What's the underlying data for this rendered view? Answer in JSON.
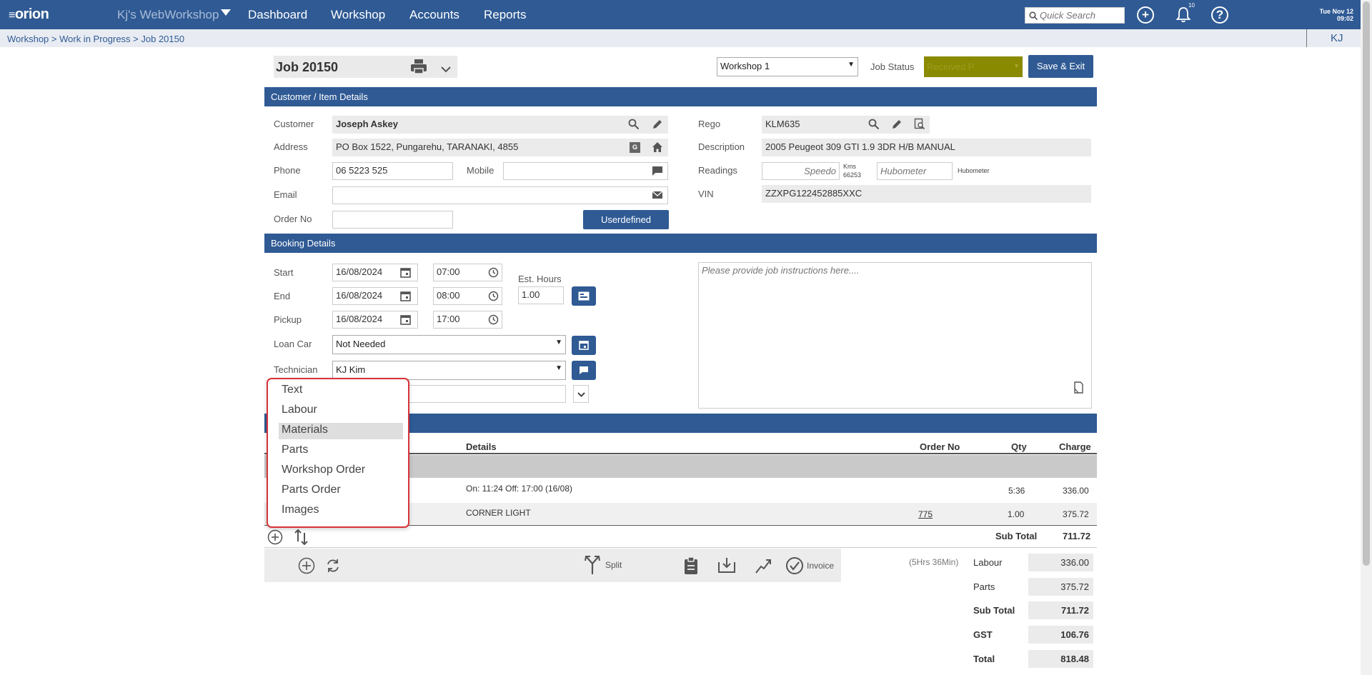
{
  "topbar": {
    "logo": "orion",
    "brand": "Kj's WebWorkshop",
    "nav": [
      "Dashboard",
      "Workshop",
      "Accounts",
      "Reports"
    ],
    "search_placeholder": "Quick Search",
    "notification_count": "10",
    "date": "Tue Nov 12",
    "time": "09:02"
  },
  "breadcrumb": "Workshop > Work in Progress > Job 20150",
  "user_initials": "KJ",
  "header": {
    "job_title": "Job 20150",
    "workshop_select": "Workshop 1",
    "job_status_label": "Job Status",
    "job_status_value": "Received P",
    "save_exit": "Save & Exit"
  },
  "customer_section": {
    "title": "Customer / Item Details",
    "customer_label": "Customer",
    "customer_value": "Joseph Askey",
    "address_label": "Address",
    "address_value": "PO Box 1522, Pungarehu, TARANAKI, 4855",
    "phone_label": "Phone",
    "phone_value": "06 5223 525",
    "mobile_label": "Mobile",
    "mobile_value": "",
    "email_label": "Email",
    "email_value": "",
    "orderno_label": "Order No",
    "orderno_value": "",
    "userdefined_button": "Userdefined",
    "rego_label": "Rego",
    "rego_value": "KLM635",
    "description_label": "Description",
    "description_value": "2005 Peugeot 309 GTI 1.9 3DR H/B MANUAL",
    "readings_label": "Readings",
    "speedo_placeholder": "Speedo",
    "kms_label": "Kms",
    "kms_value": "66253",
    "hubometer_placeholder": "Hubometer",
    "hubometer_label": "Hubometer",
    "vin_label": "VIN",
    "vin_value": "ZZXPG122452885XXC"
  },
  "booking_section": {
    "title": "Booking Details",
    "start_label": "Start",
    "start_date": "16/08/2024",
    "start_time": "07:00",
    "end_label": "End",
    "end_date": "16/08/2024",
    "end_time": "08:00",
    "pickup_label": "Pickup",
    "pickup_date": "16/08/2024",
    "pickup_time": "17:00",
    "est_hours_label": "Est. Hours",
    "est_hours_value": "1.00",
    "loan_car_label": "Loan Car",
    "loan_car_value": "Not Needed",
    "technician_label": "Technician",
    "technician_value": "KJ Kim",
    "instructions_placeholder": "Please provide job instructions here...."
  },
  "lines_table": {
    "headers": {
      "details": "Details",
      "order_no": "Order No",
      "qty": "Qty",
      "charge": "Charge"
    },
    "rows": [
      {
        "details": "On: 11:24 Off: 17:00 (16/08)",
        "order_no": "",
        "qty": "5:36",
        "charge": "336.00"
      },
      {
        "details": "CORNER LIGHT",
        "order_no": "775",
        "qty": "1.00",
        "charge": "375.72"
      }
    ],
    "subtotal_label": "Sub Total",
    "subtotal_value": "711.72"
  },
  "add_menu": {
    "items": [
      "Text",
      "Labour",
      "Materials",
      "Parts",
      "Workshop Order",
      "Parts Order",
      "Images"
    ],
    "highlighted": "Materials"
  },
  "action_bar": {
    "split": "Split",
    "invoice": "Invoice"
  },
  "totals": {
    "hours_note": "(5Hrs 36Min)",
    "labour_label": "Labour",
    "labour_value": "336.00",
    "parts_label": "Parts",
    "parts_value": "375.72",
    "subtotal_label": "Sub Total",
    "subtotal_value": "711.72",
    "gst_label": "GST",
    "gst_value": "106.76",
    "total_label": "Total",
    "total_value": "818.48"
  },
  "colors": {
    "primary": "#2f5a94",
    "status_bg": "#8a8a00",
    "highlight": "#dedede",
    "menu_border": "#d9323a"
  }
}
